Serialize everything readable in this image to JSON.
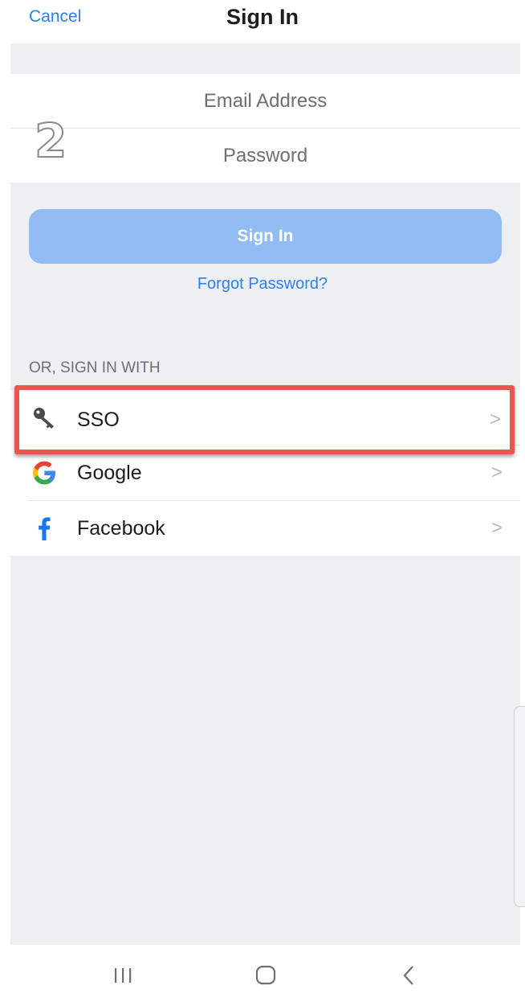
{
  "header": {
    "cancel_label": "Cancel",
    "title": "Sign In"
  },
  "form": {
    "email_placeholder": "Email Address",
    "password_placeholder": "Password",
    "step_number": "2",
    "signin_label": "Sign In",
    "forgot_label": "Forgot Password?"
  },
  "alt_signin": {
    "section_label": "OR, SIGN IN WITH",
    "options": [
      {
        "label": "SSO",
        "icon": "key-icon",
        "highlighted": true
      },
      {
        "label": "Google",
        "icon": "google-icon"
      },
      {
        "label": "Facebook",
        "icon": "facebook-icon"
      }
    ],
    "chevron": ">"
  },
  "colors": {
    "accent": "#2d7ff0",
    "button_disabled": "#92bbf1",
    "highlight": "#e8574d",
    "background": "#eeeff2"
  },
  "navbar": {
    "icons": [
      "recent-apps-icon",
      "home-icon",
      "back-icon"
    ]
  }
}
